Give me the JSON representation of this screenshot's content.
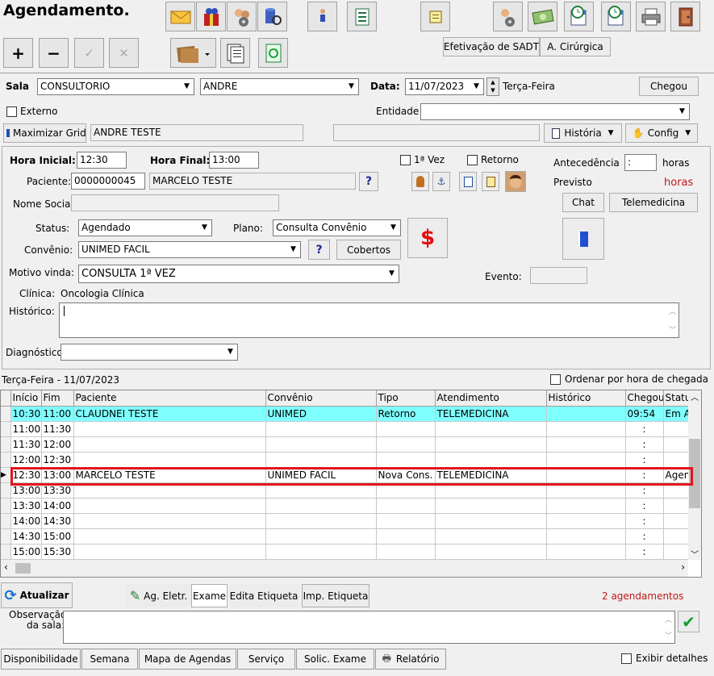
{
  "title": "Agendamento.",
  "toolbar": {
    "add": "+",
    "remove": "−",
    "confirm": "✓",
    "cancel": "✕"
  },
  "sadt_button": "Efetivação de SADT",
  "cirurgica_button": "A. Cirúrgica",
  "sala": {
    "label": "Sala",
    "value": "CONSULTORIO",
    "doctor": "ANDRE"
  },
  "data": {
    "label": "Data:",
    "value": "11/07/2023",
    "weekday": "Terça-Feira"
  },
  "chegou_button": "Chegou",
  "externo_label": "Externo",
  "entidade_label": "Entidade",
  "maximizar_label": "Maximizar Grid",
  "patient_name_bar": "ANDRE TESTE",
  "historia_label": "História",
  "config_label": "Config",
  "hora_inicial": {
    "label": "Hora Inicial:",
    "value": "12:30"
  },
  "hora_final": {
    "label": "Hora Final:",
    "value": "13:00"
  },
  "primeira_vez_label": "1ª Vez",
  "retorno_label": "Retorno",
  "antecedencia": {
    "label": "Antecedência",
    "value": ":",
    "unit": "horas"
  },
  "previsto": {
    "label": "Previsto",
    "value": "horas"
  },
  "paciente": {
    "label": "Paciente:",
    "code": "0000000045",
    "name": "MARCELO TESTE"
  },
  "help_symbol": "?",
  "nome_social_label": "Nome Social:",
  "chat_button": "Chat",
  "telemedicina_button": "Telemedicina",
  "status": {
    "label": "Status:",
    "value": "Agendado"
  },
  "plano": {
    "label": "Plano:",
    "value": "Consulta Convênio"
  },
  "convenio": {
    "label": "Convênio:",
    "value": "UNIMED FACIL"
  },
  "cobertos_button": "Cobertos",
  "dollar_symbol": "$",
  "motivo": {
    "label": "Motivo vinda:",
    "value": "CONSULTA 1ª VEZ"
  },
  "evento_label": "Evento:",
  "clinica": {
    "label": "Clínica:",
    "value": "Oncologia Clínica"
  },
  "historico_label": "Histórico:",
  "diagnostico_label": "Diagnóstico:",
  "grid_date": "Terça-Feira - 11/07/2023",
  "ordenar_label": "Ordenar por hora de chegada",
  "grid": {
    "columns": [
      "Início",
      "Fim",
      "Paciente",
      "Convênio",
      "Tipo",
      "Atendimento",
      "Histórico",
      "Chegou",
      "Status"
    ],
    "rows": [
      {
        "inicio": "10:30",
        "fim": "11:00",
        "paciente": "CLAUDNEI TESTE",
        "convenio": "UNIMED",
        "tipo": "Retorno",
        "atendimento": "TELEMEDICINA",
        "historico": "",
        "chegou": "09:54",
        "status": "Em At"
      },
      {
        "inicio": "11:00",
        "fim": "11:30",
        "paciente": "",
        "convenio": "",
        "tipo": "",
        "atendimento": "",
        "historico": "",
        "chegou": ":",
        "status": ""
      },
      {
        "inicio": "11:30",
        "fim": "12:00",
        "paciente": "",
        "convenio": "",
        "tipo": "",
        "atendimento": "",
        "historico": "",
        "chegou": ":",
        "status": ""
      },
      {
        "inicio": "12:00",
        "fim": "12:30",
        "paciente": "",
        "convenio": "",
        "tipo": "",
        "atendimento": "",
        "historico": "",
        "chegou": ":",
        "status": ""
      },
      {
        "inicio": "12:30",
        "fim": "13:00",
        "paciente": "MARCELO TESTE",
        "convenio": "UNIMED FACIL",
        "tipo": "Nova Cons.",
        "atendimento": "TELEMEDICINA",
        "historico": "",
        "chegou": ":",
        "status": "Agend"
      },
      {
        "inicio": "13:00",
        "fim": "13:30",
        "paciente": "",
        "convenio": "",
        "tipo": "",
        "atendimento": "",
        "historico": "",
        "chegou": ":",
        "status": ""
      },
      {
        "inicio": "13:30",
        "fim": "14:00",
        "paciente": "",
        "convenio": "",
        "tipo": "",
        "atendimento": "",
        "historico": "",
        "chegou": ":",
        "status": ""
      },
      {
        "inicio": "14:00",
        "fim": "14:30",
        "paciente": "",
        "convenio": "",
        "tipo": "",
        "atendimento": "",
        "historico": "",
        "chegou": ":",
        "status": ""
      },
      {
        "inicio": "14:30",
        "fim": "15:00",
        "paciente": "",
        "convenio": "",
        "tipo": "",
        "atendimento": "",
        "historico": "",
        "chegou": ":",
        "status": ""
      },
      {
        "inicio": "15:00",
        "fim": "15:30",
        "paciente": "",
        "convenio": "",
        "tipo": "",
        "atendimento": "",
        "historico": "",
        "chegou": ":",
        "status": ""
      }
    ]
  },
  "atualizar_button": "Atualizar",
  "ag_eletr_button": "Ag. Eletr.",
  "exame_button": "Exame",
  "edita_etiqueta_button": "Edita Etiqueta",
  "imp_etiqueta_button": "Imp. Etiqueta",
  "agendamentos_count": "2 agendamentos",
  "observacao_label_1": "Observação",
  "observacao_label_2": "da sala:",
  "bottom_buttons": [
    "Disponibilidade",
    "Semana",
    "Mapa de Agendas",
    "Serviço",
    "Solic. Exame",
    "Relatório"
  ],
  "exibir_detalhes_label": "Exibir detalhes",
  "colors": {
    "highlight_row": "#80ffff",
    "selection_border": "#e0141e",
    "count_text": "#c01818",
    "previsto_text": "#c01818"
  }
}
